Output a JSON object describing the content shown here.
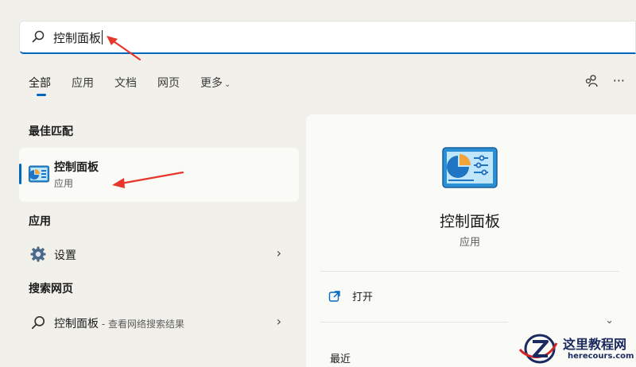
{
  "search": {
    "value": "控制面板"
  },
  "tabs": [
    {
      "label": "全部",
      "active": true
    },
    {
      "label": "应用"
    },
    {
      "label": "文档"
    },
    {
      "label": "网页"
    },
    {
      "label": "更多"
    }
  ],
  "top_icons": [
    "account-switch-icon",
    "more-options-icon"
  ],
  "best_match": {
    "heading": "最佳匹配",
    "title": "控制面板",
    "subtitle": "应用"
  },
  "apps": {
    "heading": "应用",
    "items": [
      {
        "label": "设置",
        "icon": "gear-icon"
      }
    ]
  },
  "web": {
    "heading": "搜索网页",
    "items": [
      {
        "label": "控制面板",
        "suffix": " - 查看网络搜索结果",
        "icon": "search-icon"
      }
    ]
  },
  "detail": {
    "name": "控制面板",
    "kind": "应用",
    "open_label": "打开",
    "recent_label": "最近"
  },
  "watermark": {
    "title": "这里教程网",
    "url": "herecours.com"
  },
  "colors": {
    "accent": "#0067c0",
    "annotation": "#e8362c"
  }
}
